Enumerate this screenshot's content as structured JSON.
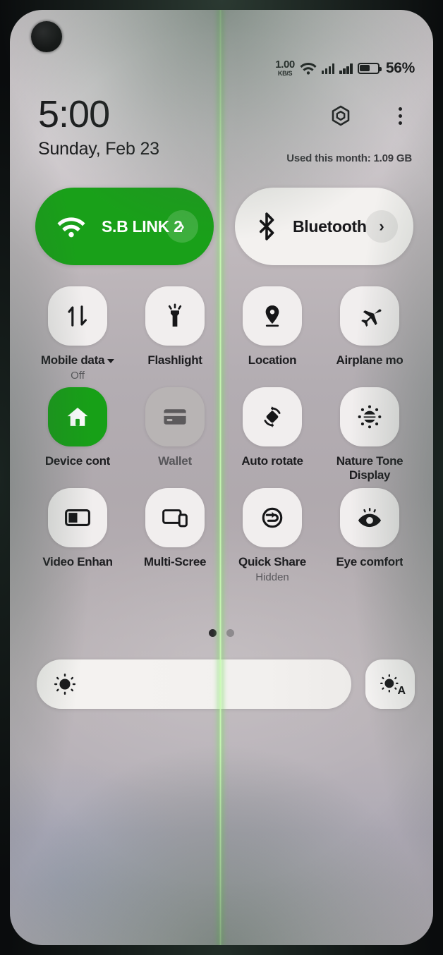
{
  "status_bar": {
    "network_speed_value": "1.00",
    "network_speed_unit": "KB/S",
    "wifi_icon": "wifi-icon",
    "signal_icon_1": "signal-bars-icon",
    "signal_icon_2": "signal-bars-icon",
    "battery_icon": "battery-icon",
    "battery_percent": "56%",
    "battery_level": 56
  },
  "header": {
    "time": "5:00",
    "date": "Sunday, Feb 23",
    "settings_icon": "gear-icon",
    "overflow_icon": "kebab-menu-icon",
    "data_usage": "Used this month: 1.09 GB"
  },
  "connectivity": [
    {
      "id": "wifi",
      "label": "S.B LINK 2",
      "icon": "wifi-icon",
      "state": "on",
      "arrow_icon": "chevron-right-icon"
    },
    {
      "id": "bluetooth",
      "label": "Bluetooth",
      "icon": "bluetooth-icon",
      "state": "off",
      "arrow_icon": "chevron-right-icon"
    }
  ],
  "tiles": [
    {
      "id": "mobile-data",
      "label": "Mobile data",
      "sub": "Off",
      "icon": "mobile-data-icon",
      "state": "off",
      "caret": true
    },
    {
      "id": "flashlight",
      "label": "Flashlight",
      "sub": "",
      "icon": "flashlight-icon",
      "state": "off",
      "caret": false
    },
    {
      "id": "location",
      "label": "Location",
      "sub": "",
      "icon": "location-pin-icon",
      "state": "off",
      "caret": false
    },
    {
      "id": "airplane-mode",
      "label": "Airplane mo",
      "sub": "",
      "icon": "airplane-icon",
      "state": "off",
      "caret": false
    },
    {
      "id": "device-control",
      "label": "Device cont",
      "sub": "",
      "icon": "home-icon",
      "state": "on",
      "caret": false
    },
    {
      "id": "wallet",
      "label": "Wallet",
      "sub": "",
      "icon": "card-icon",
      "state": "dimmed",
      "caret": false
    },
    {
      "id": "auto-rotate",
      "label": "Auto rotate",
      "sub": "",
      "icon": "auto-rotate-icon",
      "state": "off",
      "caret": false
    },
    {
      "id": "nature-tone",
      "label": "Nature Tone Display",
      "sub": "",
      "icon": "sun-rays-icon",
      "state": "off",
      "caret": false
    },
    {
      "id": "video-enhancer",
      "label": "Video Enhan",
      "sub": "",
      "icon": "video-enhancer-icon",
      "state": "off",
      "caret": false
    },
    {
      "id": "multi-screen",
      "label": "Multi-Scree",
      "sub": "",
      "icon": "multi-screen-icon",
      "state": "off",
      "caret": false
    },
    {
      "id": "quick-share",
      "label": "Quick Share",
      "sub": "Hidden",
      "icon": "quick-share-icon",
      "state": "off",
      "caret": false
    },
    {
      "id": "eye-comfort",
      "label": "Eye comfort",
      "sub": "",
      "icon": "eye-icon",
      "state": "off",
      "caret": false
    }
  ],
  "pagination": {
    "total": 2,
    "active": 1
  },
  "brightness": {
    "value_percent": 96,
    "slider_icon": "brightness-sun-icon",
    "auto_label": "A",
    "auto_icon": "brightness-auto-icon"
  },
  "colors": {
    "accent_green": "#19a019",
    "tile_bg": "#f1eeee",
    "tile_dimmed": "#b8b4b4",
    "text_primary": "#1d1d20",
    "text_secondary": "#59585c",
    "display_line_green": "#97eb78"
  }
}
